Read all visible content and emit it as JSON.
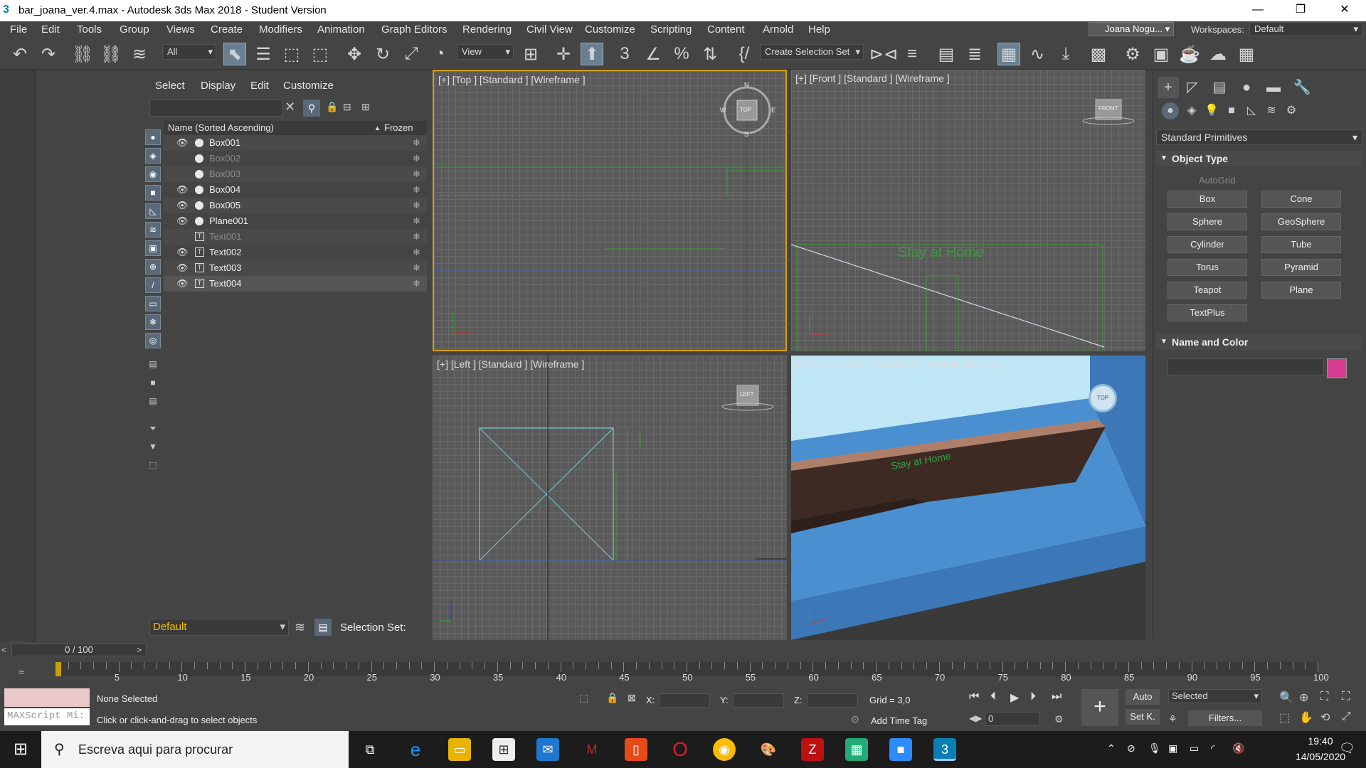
{
  "window": {
    "title": "bar_joana_ver.4.max - Autodesk 3ds Max 2018 - Student Version"
  },
  "menu": [
    "File",
    "Edit",
    "Tools",
    "Group",
    "Views",
    "Create",
    "Modifiers",
    "Animation",
    "Graph Editors",
    "Rendering",
    "Civil View",
    "Customize",
    "Scripting",
    "Content",
    "Arnold",
    "Help"
  ],
  "user": {
    "name": "Joana Nogu..."
  },
  "workspace": {
    "label": "Workspaces:",
    "value": "Default"
  },
  "toolbar": {
    "filter": "All",
    "refcoord": "View",
    "selection_set": "Create Selection Set"
  },
  "scene_explorer": {
    "menu": [
      "Select",
      "Display",
      "Edit",
      "Customize"
    ],
    "col_name": "Name (Sorted Ascending)",
    "col_frozen": "Frozen",
    "sort_arrow": "▲",
    "objects": [
      {
        "name": "Box001",
        "visible": true,
        "type": "geometry"
      },
      {
        "name": "Box002",
        "visible": false,
        "type": "geometry"
      },
      {
        "name": "Box003",
        "visible": false,
        "type": "geometry"
      },
      {
        "name": "Box004",
        "visible": true,
        "type": "geometry"
      },
      {
        "name": "Box005",
        "visible": true,
        "type": "geometry"
      },
      {
        "name": "Plane001",
        "visible": true,
        "type": "geometry"
      },
      {
        "name": "Text001",
        "visible": false,
        "type": "shape"
      },
      {
        "name": "Text002",
        "visible": true,
        "type": "shape"
      },
      {
        "name": "Text003",
        "visible": true,
        "type": "shape"
      },
      {
        "name": "Text004",
        "visible": true,
        "type": "shape"
      }
    ],
    "layer": "Default",
    "selection_set_label": "Selection Set:"
  },
  "viewports": {
    "top": "[+] [Top ] [Standard ] [Wireframe ]",
    "front": "[+] [Front ] [Standard ] [Wireframe ]",
    "left": "[+] [Left ] [Standard ] [Wireframe ]",
    "perspective": "[+] [Perspective ] [Standard ] [Default Shading ]",
    "text_label": "Stay at Home",
    "viewcube": {
      "top": "TOP",
      "front": "FRONT",
      "left": "LEFT"
    },
    "compass": {
      "n": "N",
      "s": "S",
      "e": "E",
      "w": "W"
    }
  },
  "command_panel": {
    "dropdown": "Standard Primitives",
    "object_type_title": "Object Type",
    "autogrid": "AutoGrid",
    "buttons": [
      "Box",
      "Cone",
      "Sphere",
      "GeoSphere",
      "Cylinder",
      "Tube",
      "Torus",
      "Pyramid",
      "Teapot",
      "Plane",
      "TextPlus"
    ],
    "name_color_title": "Name and Color"
  },
  "timeline": {
    "frame": "0 / 100",
    "ticks": [
      "5",
      "10",
      "15",
      "20",
      "25",
      "30",
      "35",
      "40",
      "45",
      "50",
      "55",
      "60",
      "65",
      "70",
      "75",
      "80",
      "85",
      "90",
      "95",
      "100"
    ]
  },
  "status": {
    "maxscript": "MAXScript Mi:",
    "selected": "None Selected",
    "prompt": "Click or click-and-drag to select objects",
    "x_label": "X:",
    "y_label": "Y:",
    "z_label": "Z:",
    "grid": "Grid = 3,0",
    "add_time_tag": "Add Time Tag",
    "auto": "Auto",
    "setk": "Set K.",
    "selected_dd": "Selected",
    "filters": "Filters...",
    "frame_value": "0"
  },
  "taskbar": {
    "search": "Escreva aqui para procurar",
    "time": "19:40",
    "date": "14/05/2020"
  }
}
